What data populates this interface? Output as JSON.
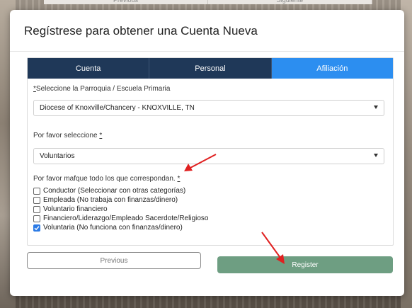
{
  "background_nav": {
    "previous_label": "Previous",
    "next_label": "Siguiente"
  },
  "modal": {
    "title": "Regístrese para obtener una Cuenta Nueva"
  },
  "tabs": [
    {
      "label": "Cuenta",
      "active": false
    },
    {
      "label": "Personal",
      "active": false
    },
    {
      "label": "Afiliación",
      "active": true
    }
  ],
  "form": {
    "parish_label": "*Seleccione la Parroquia / Escuela Primaria",
    "parish_value": "Diocese of Knoxville/Chancery - KNOXVILLE, TN",
    "select_label": "Por favor seleccione",
    "select_value": "Voluntarios",
    "checks_label": "Por favor mafque todo los que correspondan.",
    "required_marker": "*",
    "options": [
      {
        "label": "Conductor (Seleccionar con otras categorías)",
        "checked": false
      },
      {
        "label": "Empleada (No trabaja con finanzas/dinero)",
        "checked": false
      },
      {
        "label": "Voluntario financiero",
        "checked": false
      },
      {
        "label": "Financiero/Liderazgo/Empleado Sacerdote/Religioso",
        "checked": false
      },
      {
        "label": "Voluntaria (No funciona con finanzas/dinero)",
        "checked": true
      }
    ]
  },
  "buttons": {
    "previous": "Previous",
    "register": "Register"
  },
  "colors": {
    "tab_inactive": "#1f3858",
    "tab_active": "#2c8ef0",
    "register_button": "#6e9e82",
    "checkbox_checked": "#2c7be5",
    "annotation_arrow": "#e02020"
  }
}
